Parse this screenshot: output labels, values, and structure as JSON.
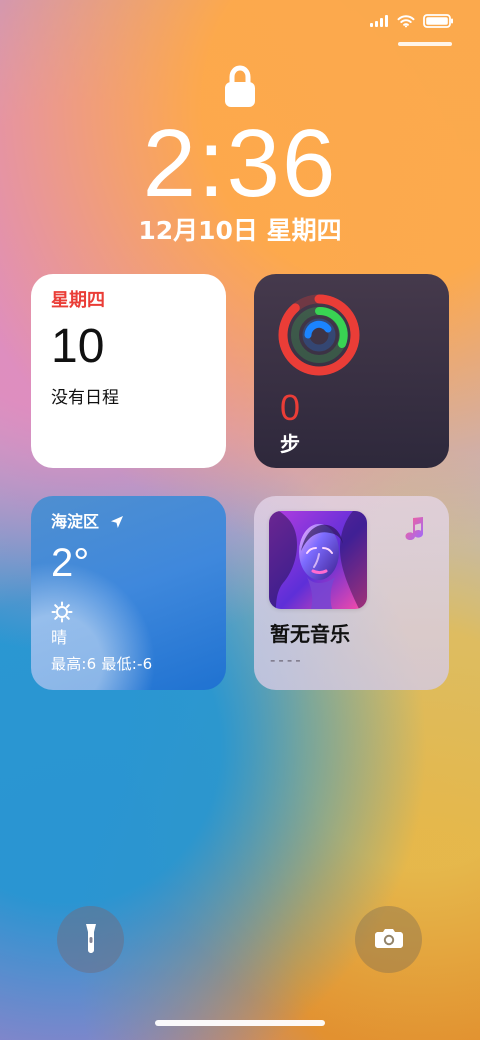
{
  "status_bar": {
    "signal_icon": "signal-bars-icon",
    "wifi_icon": "wifi-icon",
    "battery_icon": "battery-icon"
  },
  "lock_screen": {
    "time": "2:36",
    "date": "12月10日 星期四",
    "lock_icon": "lock-icon"
  },
  "widgets": {
    "calendar": {
      "day_name": "星期四",
      "day_number": "10",
      "events_text": "没有日程"
    },
    "activity": {
      "steps_value": "0",
      "steps_unit": "步",
      "ring_icon": "activity-rings-icon",
      "colors": {
        "move": "#ea3d37",
        "exercise": "#39d353",
        "stand": "#1b84ff"
      }
    },
    "weather": {
      "location": "海淀区",
      "location_icon": "location-arrow-icon",
      "temperature": "2°",
      "condition": "晴",
      "condition_icon": "sun-icon",
      "range": "最高:6 最低:-6"
    },
    "music": {
      "title": "暂无音乐",
      "subtitle": "----",
      "music_icon": "music-note-icon"
    }
  },
  "controls": {
    "flashlight_icon": "flashlight-icon",
    "camera_icon": "camera-icon"
  }
}
